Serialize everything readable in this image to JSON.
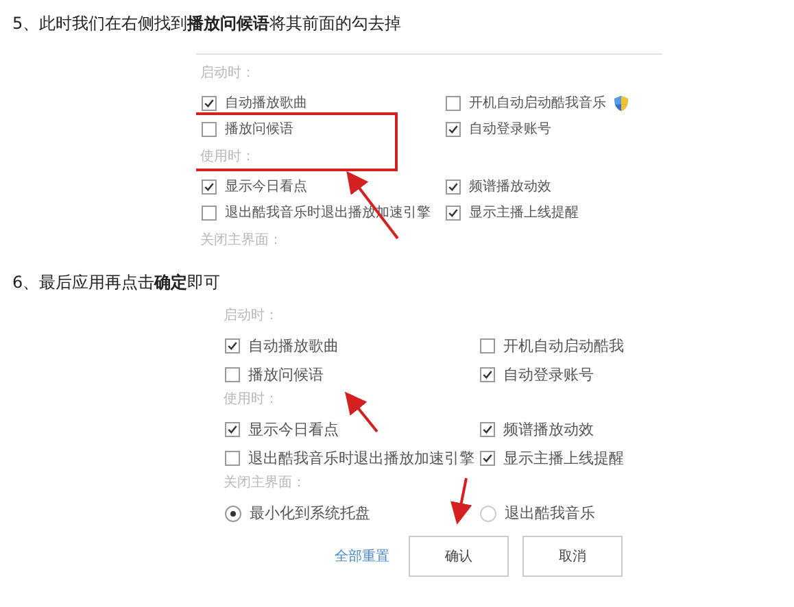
{
  "steps": [
    {
      "heading": "5、此时我们在右侧找到**播放问候语**将其前面的勾去掉",
      "screenshot": {
        "top_rule": true,
        "sections": [
          {
            "label": "启动时：",
            "items": [
              {
                "kind": "checkbox",
                "label": "自动播放歌曲",
                "checked": true
              },
              {
                "kind": "checkbox_shield",
                "label": "开机自动启动酷我音乐",
                "checked": false
              },
              {
                "kind": "checkbox",
                "label": "播放问候语",
                "checked": false
              },
              {
                "kind": "checkbox",
                "label": "自动登录账号",
                "checked": true
              }
            ]
          },
          {
            "label": "使用时：",
            "items": [
              {
                "kind": "checkbox",
                "label": "显示今日看点",
                "checked": true
              },
              {
                "kind": "checkbox",
                "label": "频谱播放动效",
                "checked": true
              },
              {
                "kind": "checkbox",
                "label": "退出酷我音乐时退出播放加速引擎",
                "checked": false
              },
              {
                "kind": "checkbox",
                "label": "显示主播上线提醒",
                "checked": true
              }
            ]
          },
          {
            "label": "关闭主界面："
          }
        ]
      }
    },
    {
      "heading": "6、最后应用再点击**确定**即可",
      "screenshot": {
        "sections": [
          {
            "label": "启动时：",
            "items": [
              {
                "kind": "checkbox",
                "label": "自动播放歌曲",
                "checked": true
              },
              {
                "kind": "checkbox",
                "label": "开机自动启动酷我",
                "checked": false
              },
              {
                "kind": "checkbox",
                "label": "播放问候语",
                "checked": false
              },
              {
                "kind": "checkbox",
                "label": "自动登录账号",
                "checked": true
              }
            ]
          },
          {
            "label": "使用时：",
            "items": [
              {
                "kind": "checkbox",
                "label": "显示今日看点",
                "checked": true
              },
              {
                "kind": "checkbox",
                "label": "频谱播放动效",
                "checked": true
              },
              {
                "kind": "checkbox",
                "label": "退出酷我音乐时退出播放加速引擎",
                "checked": false
              },
              {
                "kind": "checkbox",
                "label": "显示主播上线提醒",
                "checked": true
              }
            ]
          },
          {
            "label": "关闭主界面：",
            "items": [
              {
                "kind": "radio",
                "label": "最小化到系统托盘",
                "selected": true
              },
              {
                "kind": "radio",
                "label": "退出酷我音乐",
                "selected": false
              }
            ]
          }
        ],
        "buttons": [
          {
            "kind": "link",
            "label": "全部重置"
          },
          {
            "kind": "button",
            "label": "确认"
          },
          {
            "kind": "button",
            "label": "取消"
          }
        ]
      }
    }
  ]
}
